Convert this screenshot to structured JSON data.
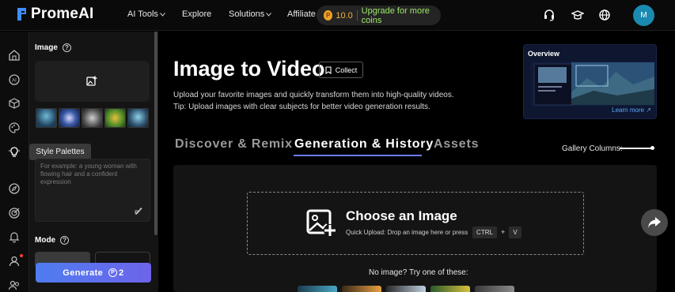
{
  "header": {
    "brand": "PromeAI",
    "nav": [
      {
        "label": "AI Tools",
        "has_caret": true
      },
      {
        "label": "Explore",
        "has_caret": false
      },
      {
        "label": "Solutions",
        "has_caret": true
      },
      {
        "label": "Affiliate",
        "has_caret": false
      }
    ],
    "coins": "10.0",
    "upgrade_label": "Upgrade for more coins",
    "avatar_initial": "M",
    "icons": [
      "headset-icon",
      "graduation-cap-icon",
      "globe-icon"
    ]
  },
  "rail": {
    "icons": [
      "home-icon",
      "ai-icon",
      "cube-icon",
      "palette-icon",
      "bulb-icon",
      "compass-icon",
      "target-icon",
      "bell-icon",
      "user-icon",
      "people-icon"
    ]
  },
  "panel": {
    "image_label": "Image",
    "tooltip": "Style Palettes",
    "prompt_placeholder": "For example: a young woman with flowing hair and a confident expression",
    "mode_label": "Mode",
    "generate_label": "Generate",
    "generate_cost": "2"
  },
  "main": {
    "title": "Image to Video",
    "collect_label": "Collect",
    "description_1": "Upload your favorite images and quickly transform them into high-quality videos.",
    "description_2": "Tip: Upload images with clear subjects for better video generation results.",
    "overview_title": "Overview",
    "overview_link": "Learn more ↗",
    "tabs": [
      {
        "label": "Discover & Remix",
        "active": false
      },
      {
        "label": "Generation & History",
        "active": true
      },
      {
        "label": "Assets",
        "active": false
      }
    ],
    "gallery_columns_label": "Gallery Columns:",
    "choose_title": "Choose an Image",
    "quick_upload": "Quick Upload: Drop an image here or press",
    "kbd_ctrl": "CTRL",
    "kbd_plus": "+",
    "kbd_v": "V",
    "no_image": "No image? Try one of these:"
  },
  "colors": {
    "accent": "#6b7cf0",
    "upgrade": "#9ee86a",
    "coin": "#f0a12a",
    "avatar": "#1a8ab0"
  }
}
